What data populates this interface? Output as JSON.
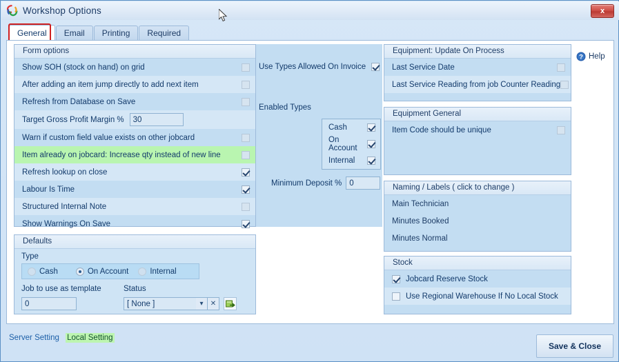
{
  "window": {
    "title": "Workshop Options",
    "app_icon": "swirl-logo-icon",
    "close_label": "x"
  },
  "tabs": [
    {
      "label": "General",
      "active": true
    },
    {
      "label": "Email",
      "active": false
    },
    {
      "label": "Printing",
      "active": false
    },
    {
      "label": "Required",
      "active": false
    }
  ],
  "help": {
    "label": "Help",
    "icon": "question-mark-icon"
  },
  "form_options": {
    "title": "Form options",
    "rows": [
      {
        "label": "Show SOH (stock on hand) on grid",
        "checked": false
      },
      {
        "label": "After adding an item jump directly to add next item",
        "checked": false
      },
      {
        "label": "Refresh from Database on Save",
        "checked": false
      },
      {
        "label": "Warn if custom field value exists on other jobcard",
        "checked": false
      },
      {
        "label": "Item already on jobcard: Increase qty instead of new line",
        "checked": false,
        "highlighted": true
      },
      {
        "label": "Refresh lookup on close",
        "checked": true
      },
      {
        "label": "Labour Is Time",
        "checked": true
      },
      {
        "label": "Structured Internal Note",
        "checked": false
      },
      {
        "label": "Show Warnings On Save",
        "checked": true
      }
    ],
    "margin_field": {
      "label": "Target Gross Profit Margin  %",
      "value": "30"
    }
  },
  "invoice_types": {
    "use_types_label": "Use Types Allowed On Invoice",
    "use_types_checked": true,
    "enabled_types_label": "Enabled Types",
    "types": [
      {
        "label": "Cash",
        "checked": true
      },
      {
        "label": "On Account",
        "checked": true
      },
      {
        "label": "Internal",
        "checked": true
      }
    ],
    "min_deposit_label": "Minimum Deposit %",
    "min_deposit_value": "0"
  },
  "defaults": {
    "title": "Defaults",
    "type_label": "Type",
    "type_options": [
      {
        "label": "Cash",
        "selected": false
      },
      {
        "label": "On Account",
        "selected": true
      },
      {
        "label": "Internal",
        "selected": false
      }
    ],
    "job_template_label": "Job to use as template",
    "job_template_value": "0",
    "status_label": "Status",
    "status_value": "[ None ]",
    "dropdown_icon": "chevron-down-icon",
    "clear_icon": "clear-x-icon",
    "lookup_icon": "green-lookup-icon"
  },
  "equipment_update": {
    "title": "Equipment: Update On Process",
    "rows": [
      {
        "label": "Last Service Date",
        "checked": false
      },
      {
        "label": "Last Service Reading from job Counter Reading",
        "checked": false
      }
    ]
  },
  "equipment_general": {
    "title": "Equipment General",
    "rows": [
      {
        "label": "Item Code should be unique",
        "checked": false
      }
    ]
  },
  "naming_labels": {
    "title": "Naming / Labels ( click to change )",
    "rows": [
      {
        "label": "Main Technician"
      },
      {
        "label": "Minutes Booked"
      },
      {
        "label": "Minutes Normal"
      }
    ]
  },
  "stock": {
    "title": "Stock",
    "rows": [
      {
        "label": "Jobcard Reserve Stock",
        "checked": true
      },
      {
        "label": "Use Regional Warehouse If No Local Stock",
        "checked": false
      }
    ]
  },
  "footer": {
    "server_setting": "Server Setting",
    "local_setting": "Local Setting",
    "save_label": "Save & Close"
  },
  "colors": {
    "panel": "#c3ddf2",
    "accent": "#1d5fa8",
    "highlight_green": "#b9f5b0",
    "close_red": "#cf5048"
  }
}
